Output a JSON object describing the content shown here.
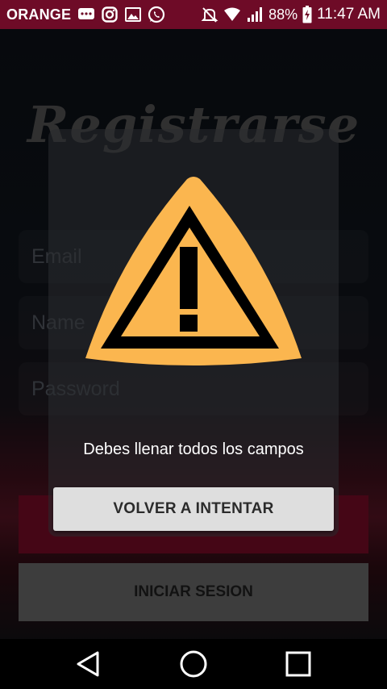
{
  "status_bar": {
    "carrier": "ORANGE",
    "notification_icons": [
      "messages-icon",
      "instagram-icon",
      "gallery-icon",
      "whatsapp-icon"
    ],
    "system_icons": [
      "mute-icon",
      "wifi-icon",
      "signal-icon",
      "battery-charging-icon"
    ],
    "battery": "88%",
    "time": "11:47 AM"
  },
  "screen": {
    "title": "Registrarse",
    "email_placeholder": "Email",
    "name_placeholder": "Name",
    "password_placeholder": "Password",
    "login_label": "INICIAR SESION"
  },
  "dialog": {
    "icon": "warning-icon",
    "message": "Debes llenar todos los campos",
    "retry_label": "VOLVER A INTENTAR"
  },
  "nav_bar": {
    "buttons": [
      "back-icon",
      "home-icon",
      "recents-icon"
    ]
  },
  "colors": {
    "status_bar": "#6e0b27",
    "register_button": "#6a0a22",
    "login_button": "#5e5e5e",
    "warning_fill": "#fbb64f",
    "retry_button": "#dedede"
  }
}
